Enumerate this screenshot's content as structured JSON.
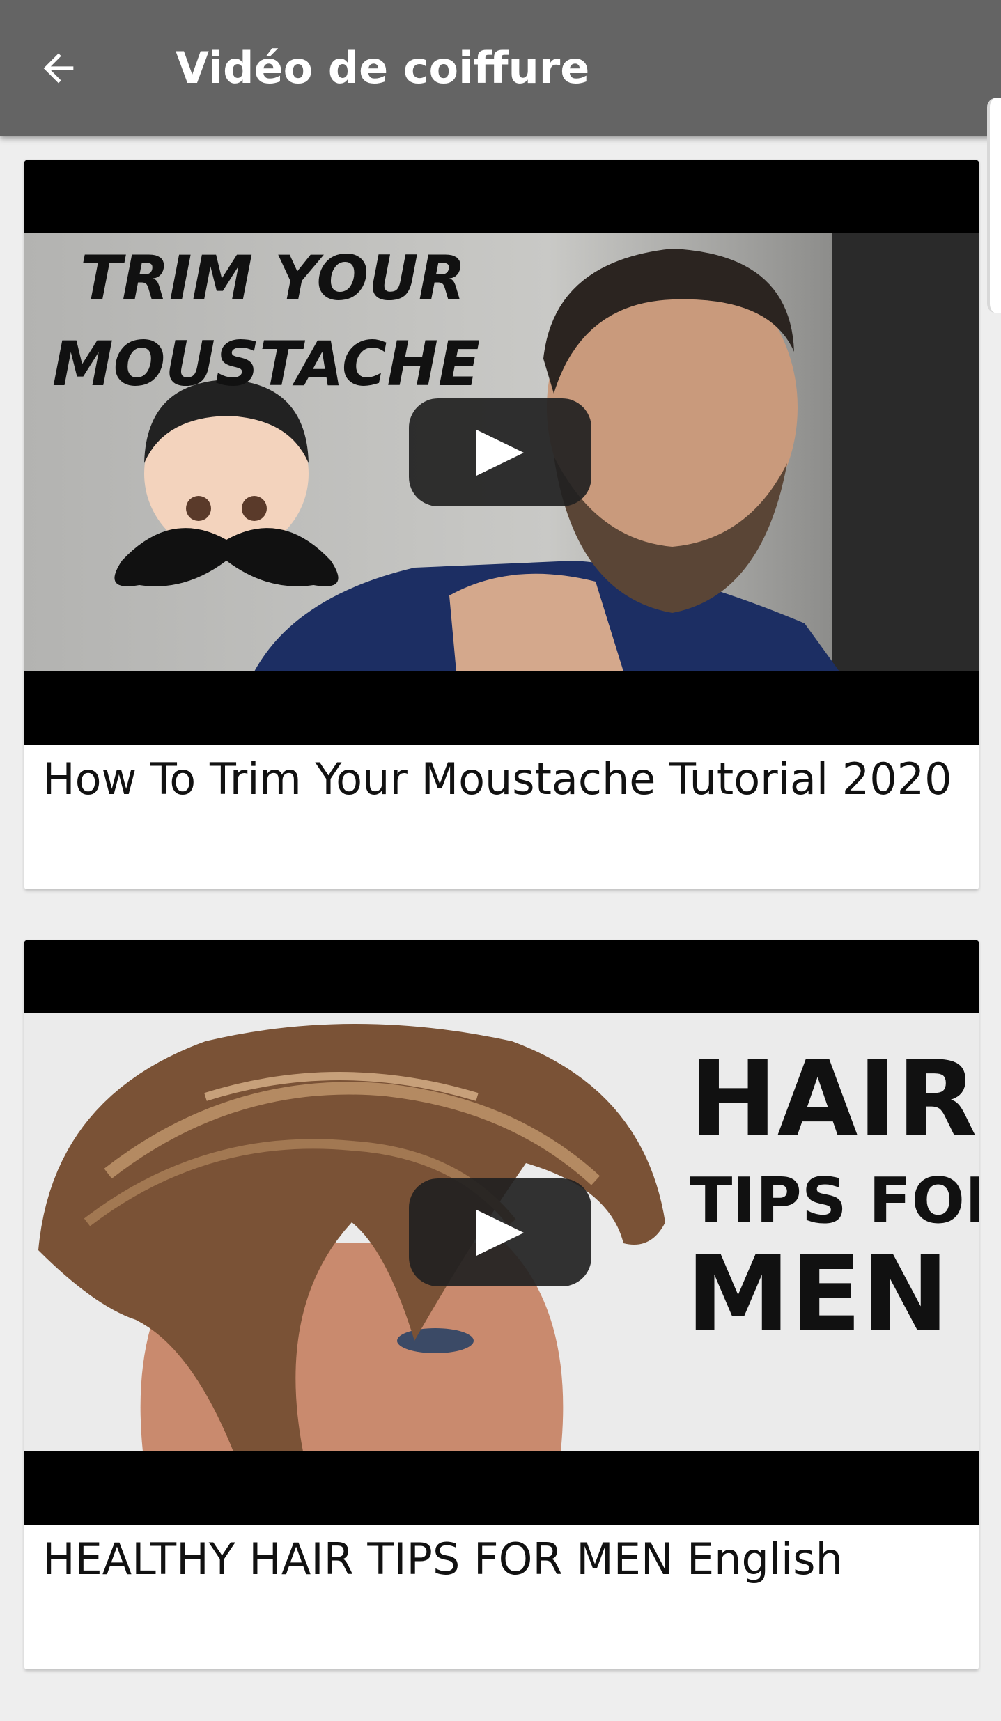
{
  "appbar": {
    "title": "Vidéo de coiffure",
    "back_icon": "arrow-left-icon",
    "background": "#646464"
  },
  "videos": [
    {
      "title": "How To Trim Your Moustache Tutorial 2020",
      "thumbnail_text": [
        "TRIM YOUR",
        "MOUSTACHE"
      ],
      "play_icon": "play-icon"
    },
    {
      "title": "HEALTHY HAIR TIPS FOR MEN English",
      "thumbnail_text": [
        "HAIR",
        "TIPS FOR",
        "MEN"
      ],
      "play_icon": "play-icon"
    }
  ]
}
